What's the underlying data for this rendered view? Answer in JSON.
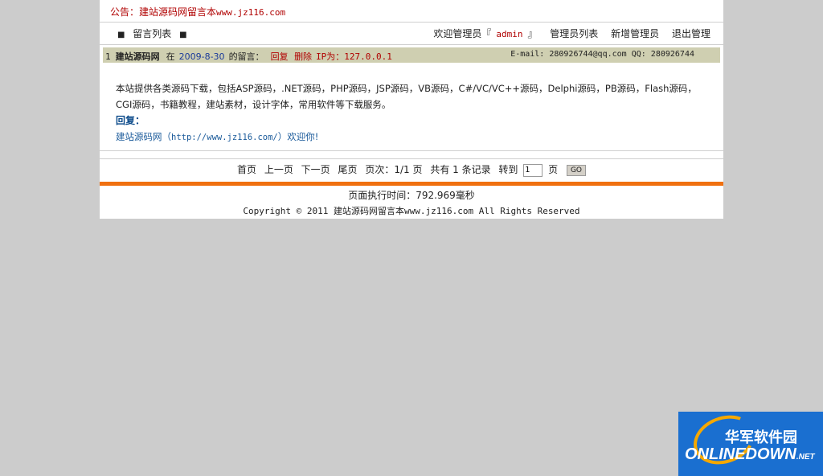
{
  "notice": {
    "prefix": "公告：建站源码网留言本",
    "url": "www.jz116.com"
  },
  "nav": {
    "left_items": [
      "留言列表"
    ],
    "welcome_prefix": "欢迎管理员『",
    "admin_name": "admin",
    "welcome_suffix": "』",
    "links": [
      "管理员列表",
      "新增管理员",
      "退出管理"
    ]
  },
  "message": {
    "number": "1",
    "author": "建站源码网",
    "at_label": "在",
    "date": "2009-8-30",
    "posted_label": "的留言：",
    "reply_action": "回复",
    "delete_action": "删除",
    "ip_label": "IP为：127.0.0.1",
    "email": "E-mail: 280926744@qq.com",
    "qq": "QQ: 280926744",
    "content": "本站提供各类源码下载，包括ASP源码，.NET源码，PHP源码，JSP源码，VB源码，C#/VC/VC++源码，Delphi源码，PB源码，Flash源码，CGI源码，书籍教程，建站素材，设计字体，常用软件等下载服务。",
    "reply_title": "回复：",
    "reply_prefix": "建站源码网（",
    "reply_url": "http://www.jz116.com/",
    "reply_suffix": "）欢迎你!"
  },
  "pagination": {
    "first": "首页",
    "prev": "上一页",
    "next": "下一页",
    "last": "尾页",
    "pages": "页次：1/1 页",
    "total": "共有 1 条记录",
    "goto_label": "转到",
    "goto_value": "1",
    "page_suffix": "页",
    "go_button": "GO"
  },
  "footer": {
    "exec_time": "页面执行时间：792.969毫秒",
    "copyright": "Copyright © 2011 建站源码网留言本www.jz116.com All Rights Reserved"
  },
  "watermark": {
    "cn": "华军软件园",
    "en": "ONLINEDOWN",
    "net": ".NET"
  },
  "colors": {
    "accent_red": "#b00000",
    "orange_bar": "#f07010",
    "header_bg": "#cfcfb1"
  }
}
